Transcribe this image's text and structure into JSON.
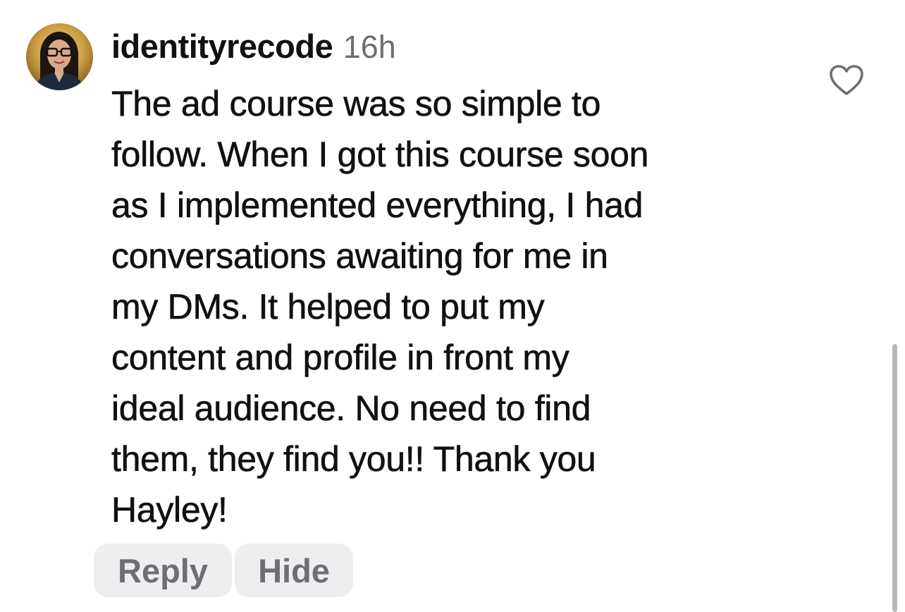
{
  "comment": {
    "username": "identityrecode",
    "timestamp": "16h",
    "body_lines": [
      "The ad course was so simple to",
      "follow. When I got this course soon",
      "as I implemented everything, I had",
      "conversations awaiting for me in",
      "my DMs. It helped to put my",
      "content and profile in front my",
      "ideal audience. No need to find",
      "them, they find you!! Thank you",
      "Hayley!"
    ],
    "avatar_icon": "user-avatar-photo",
    "like_icon": "heart-outline-icon"
  },
  "actions": {
    "reply_label": "Reply",
    "hide_label": "Hide"
  },
  "colors": {
    "text_primary": "#111111",
    "text_secondary": "#6e6e73",
    "chip_background": "#eeeef0",
    "like_icon": "#6e6e73",
    "background": "#ffffff"
  }
}
